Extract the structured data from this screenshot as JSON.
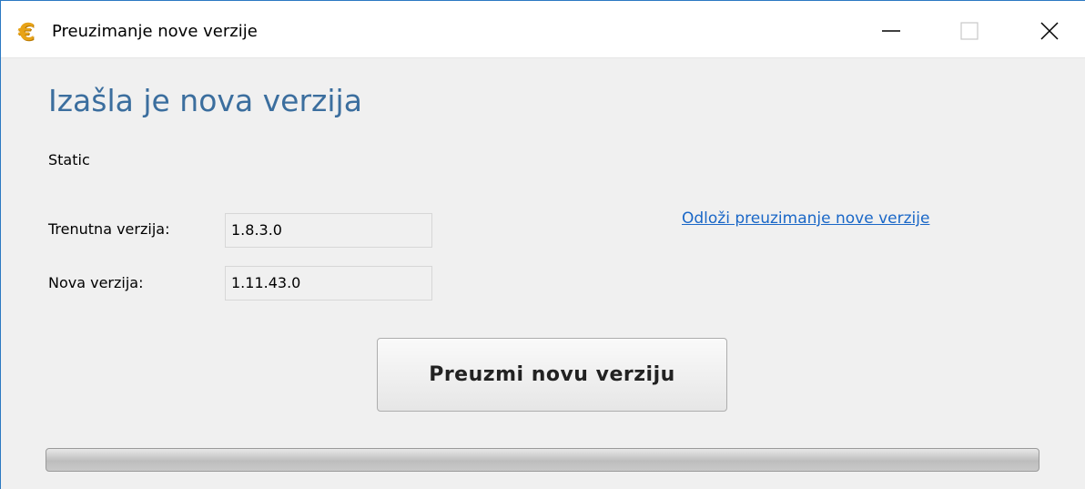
{
  "window": {
    "title": "Preuzimanje nove verzije",
    "icon": "euro-icon",
    "icon_glyph": "€",
    "caption_buttons": [
      "minimize",
      "maximize",
      "close"
    ]
  },
  "main": {
    "heading": "Izašla je nova verzija",
    "static_text": "Static",
    "current_version_label": "Trenutna verzija:",
    "current_version_value": "1.8.3.0",
    "new_version_label": "Nova verzija:",
    "new_version_value": "1.11.43.0",
    "postpone_link": "Odloži preuzimanje nove verzije",
    "download_button": "Preuzmi novu verziju"
  },
  "progress": {
    "value_percent": 0
  },
  "colors": {
    "heading": "#3b6e9e",
    "link": "#1a67c7",
    "window_border": "#2b79c2",
    "icon": "#e8a317",
    "background": "#f0f0f0"
  }
}
